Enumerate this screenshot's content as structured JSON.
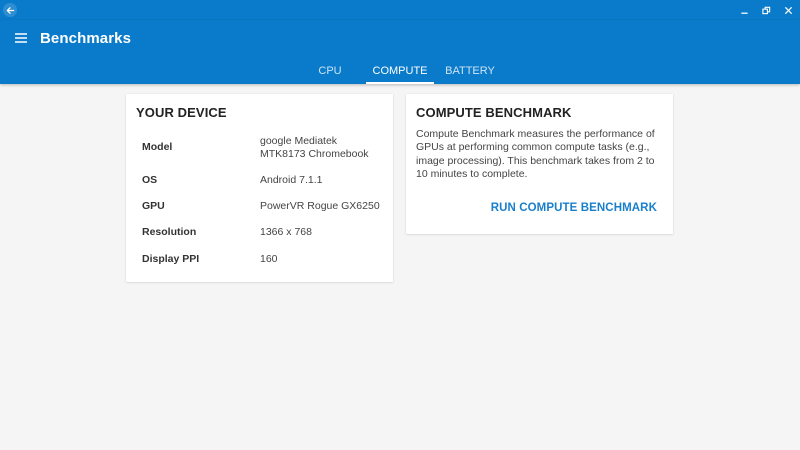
{
  "app": {
    "title": "Benchmarks"
  },
  "tabs": [
    {
      "label": "CPU",
      "active": false
    },
    {
      "label": "COMPUTE",
      "active": true
    },
    {
      "label": "BATTERY",
      "active": false
    }
  ],
  "device_card": {
    "title": "YOUR DEVICE",
    "specs": [
      {
        "label": "Model",
        "value": "google Mediatek MTK8173 Chromebook"
      },
      {
        "label": "OS",
        "value": "Android 7.1.1"
      },
      {
        "label": "GPU",
        "value": "PowerVR Rogue GX6250"
      },
      {
        "label": "Resolution",
        "value": "1366 x 768"
      },
      {
        "label": "Display PPI",
        "value": "160"
      }
    ]
  },
  "compute_card": {
    "title": "COMPUTE BENCHMARK",
    "description": "Compute Benchmark measures the performance of GPUs at performing common compute tasks (e.g., image processing). This benchmark takes from 2 to 10 minutes to complete.",
    "run_label": "RUN COMPUTE BENCHMARK"
  },
  "colors": {
    "app_bar": "#0a7bcb",
    "accent": "#1a7fcb",
    "background": "#f5f5f5"
  },
  "icons": {
    "back": "back-arrow-icon",
    "menu": "hamburger-menu-icon",
    "minimize": "minimize-icon",
    "restore": "restore-icon",
    "close": "close-icon"
  }
}
